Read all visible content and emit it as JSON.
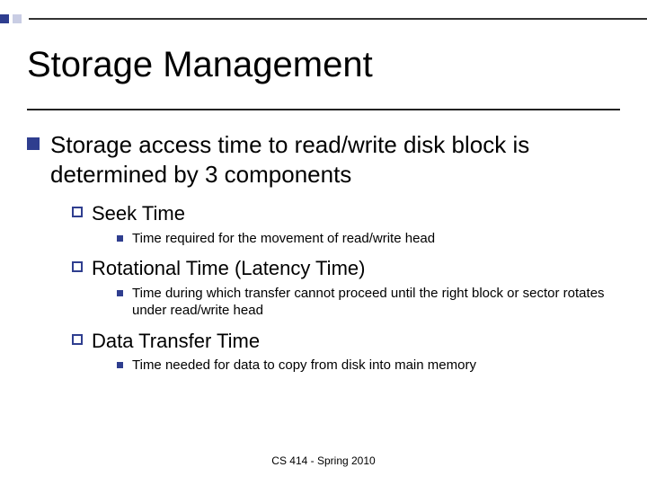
{
  "title": "Storage Management",
  "main": {
    "intro": "Storage access time to read/write disk block is determined by 3 components",
    "items": [
      {
        "label": "Seek Time",
        "desc": "Time required for the movement of read/write head"
      },
      {
        "label": "Rotational Time (Latency Time)",
        "desc": "Time during which transfer cannot proceed until the right block or sector rotates under read/write head"
      },
      {
        "label": "Data Transfer Time",
        "desc": "Time needed for data to copy from disk into main memory"
      }
    ]
  },
  "footer": "CS 414 - Spring 2010"
}
